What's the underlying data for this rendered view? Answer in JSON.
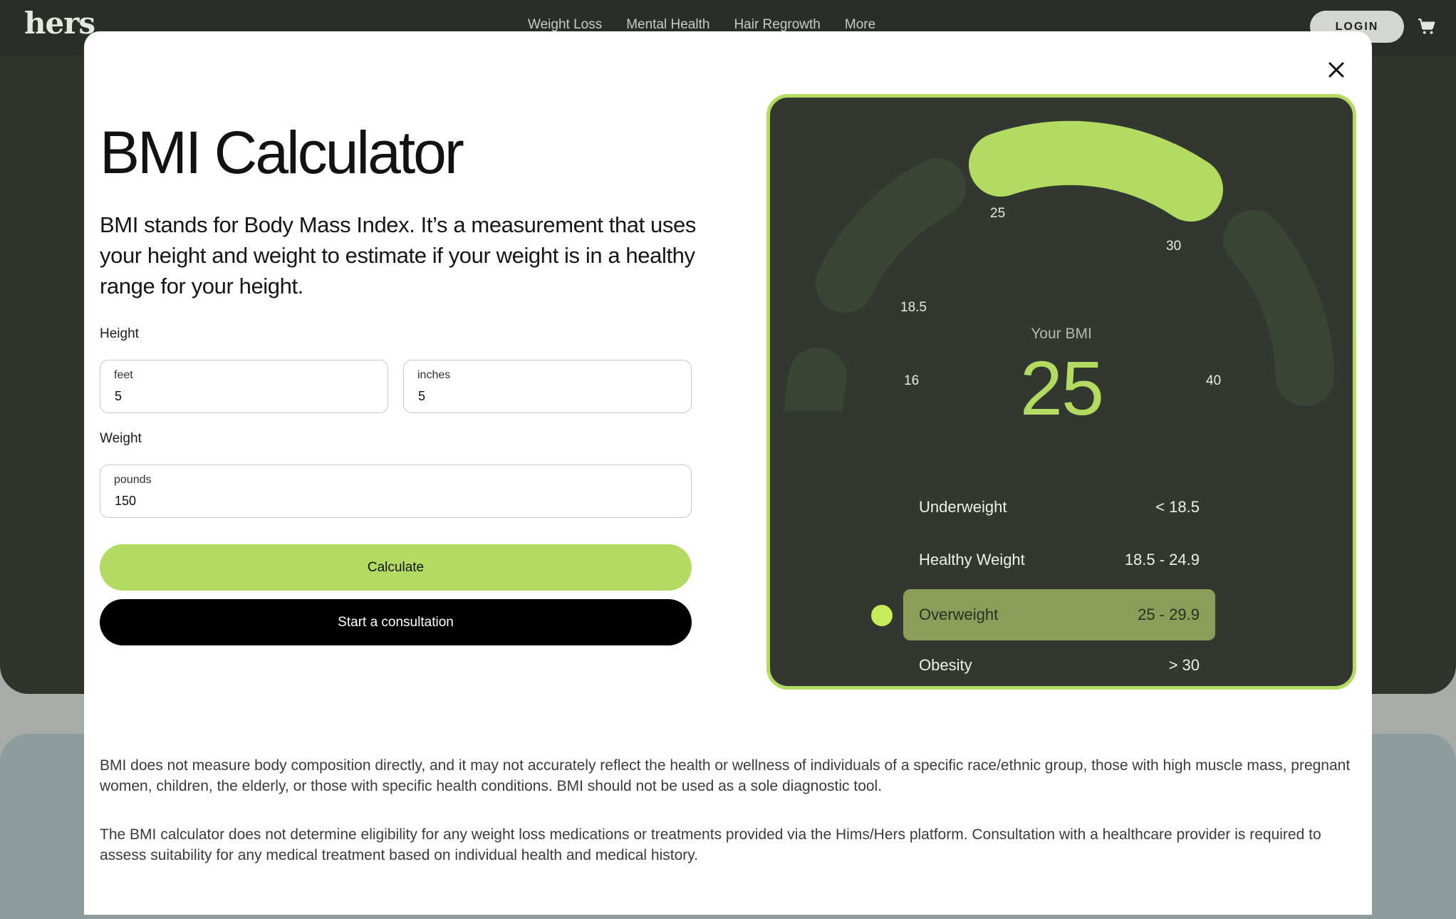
{
  "nav": {
    "logo": "hers",
    "links": [
      "Weight Loss",
      "Mental Health",
      "Hair Regrowth",
      "More"
    ],
    "login": "LOGIN"
  },
  "modal": {
    "title": "BMI Calculator",
    "intro": "BMI stands for Body Mass Index. It’s a measurement that uses your height and weight to estimate if your weight is in a healthy range for your height.",
    "height_label": "Height",
    "feet": {
      "sublabel": "feet",
      "value": "5"
    },
    "inches": {
      "sublabel": "inches",
      "value": "5"
    },
    "weight_label": "Weight",
    "pounds": {
      "sublabel": "pounds",
      "value": "150"
    },
    "calculate": "Calculate",
    "consult": "Start a consultation"
  },
  "gauge": {
    "ticks": [
      "16",
      "18.5",
      "25",
      "30",
      "40"
    ],
    "your_bmi_label": "Your BMI",
    "bmi_value": "25",
    "active_segment": "25 - 30",
    "colors": {
      "active": "#b3db62",
      "inactive": "#3b4536",
      "panel": "#323730"
    }
  },
  "categories": [
    {
      "name": "Underweight",
      "range": "< 18.5"
    },
    {
      "name": "Healthy Weight",
      "range": "18.5 - 24.9"
    },
    {
      "name": "Overweight",
      "range": "25 - 29.9"
    },
    {
      "name": "Obesity",
      "range": "> 30"
    }
  ],
  "disclaimers": [
    "BMI does not measure body composition directly, and it may not accurately reflect the health or wellness of individuals of a specific race/ethnic group, those with high muscle mass, pregnant women, children, the elderly, or those with specific health conditions. BMI should not be used as a sole diagnostic tool.",
    "The BMI calculator does not determine eligibility for any weight loss medications or treatments provided via the Hims/Hers platform. Consultation with a healthcare provider is required to assess suitability for any medical treatment based on individual health and medical history."
  ]
}
